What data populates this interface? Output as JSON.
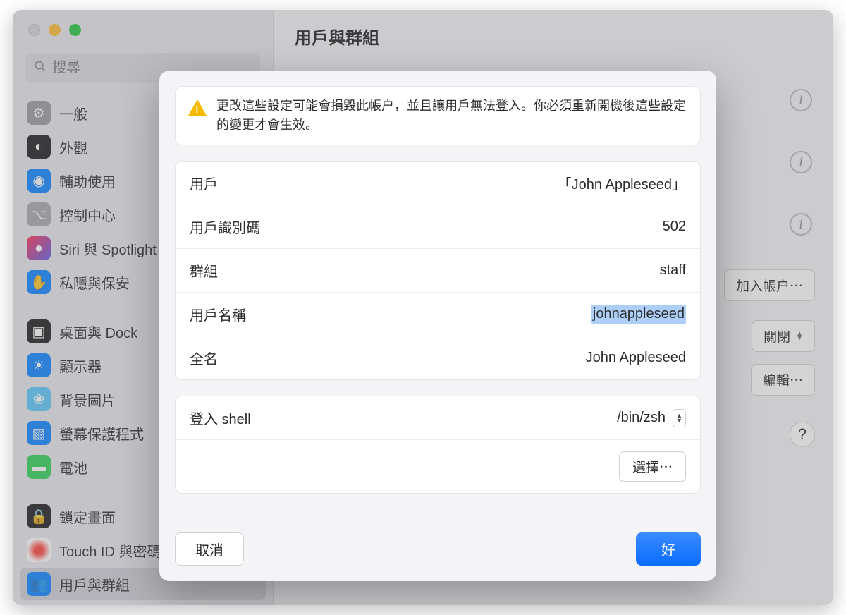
{
  "window": {
    "title": "用戶與群組"
  },
  "search": {
    "placeholder": "搜尋"
  },
  "sidebar": {
    "items": [
      {
        "label": "一般",
        "iconClass": "ic-general",
        "glyph": "⚙"
      },
      {
        "label": "外觀",
        "iconClass": "ic-appearance",
        "glyph": "◐"
      },
      {
        "label": "輔助使用",
        "iconClass": "ic-accessibility",
        "glyph": "◉"
      },
      {
        "label": "控制中心",
        "iconClass": "ic-control",
        "glyph": "⌥"
      },
      {
        "label": "Siri 與 Spotlight",
        "iconClass": "ic-siri",
        "glyph": "●"
      },
      {
        "label": "私隱與保安",
        "iconClass": "ic-privacy",
        "glyph": "✋"
      },
      {
        "spacer": true
      },
      {
        "label": "桌面與 Dock",
        "iconClass": "ic-desktop",
        "glyph": "▣"
      },
      {
        "label": "顯示器",
        "iconClass": "ic-display",
        "glyph": "☀"
      },
      {
        "label": "背景圖片",
        "iconClass": "ic-wallpaper",
        "glyph": "❀"
      },
      {
        "label": "螢幕保護程式",
        "iconClass": "ic-screensaver",
        "glyph": "▧"
      },
      {
        "label": "電池",
        "iconClass": "ic-battery",
        "glyph": "▬"
      },
      {
        "spacer": true
      },
      {
        "label": "鎖定畫面",
        "iconClass": "ic-lock",
        "glyph": "🔒"
      },
      {
        "label": "Touch ID 與密碼",
        "iconClass": "ic-touchid",
        "glyph": "◉"
      },
      {
        "label": "用戶與群組",
        "iconClass": "ic-users",
        "glyph": "👥",
        "selected": true
      }
    ]
  },
  "main_actions": {
    "add_account": "加入帳户⋯",
    "close": "關閉",
    "edit": "編輯⋯",
    "help": "?"
  },
  "dialog": {
    "warning": "更改這些設定可能會損毀此帳户，並且讓用戶無法登入。你必須重新開機後這些設定的變更才會生效。",
    "rows": {
      "user_label": "用戶",
      "user_value": "「John Appleseed」",
      "uid_label": "用戶識別碼",
      "uid_value": "502",
      "group_label": "群組",
      "group_value": "staff",
      "username_label": "用戶名稱",
      "username_value": "johnappleseed",
      "fullname_label": "全名",
      "fullname_value": "John Appleseed",
      "shell_label": "登入 shell",
      "shell_value": "/bin/zsh",
      "choose": "選擇⋯"
    },
    "cancel": "取消",
    "ok": "好"
  }
}
